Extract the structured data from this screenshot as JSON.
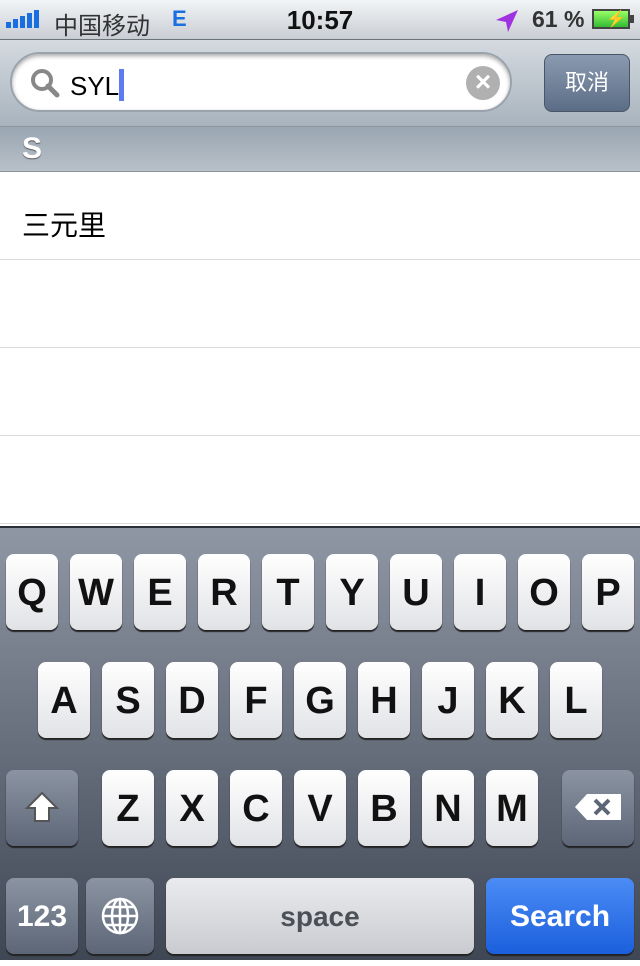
{
  "status": {
    "carrier": "中国移动",
    "network": "E",
    "time": "10:57",
    "battery": "61 %",
    "battery_level": 0.61,
    "colors": {
      "signal": "#1a6fe0",
      "location": "#a033e0"
    }
  },
  "search": {
    "value": "SYL",
    "clear_icon": "clear-circle-icon",
    "cancel_label": "取消"
  },
  "section": {
    "header": "S"
  },
  "results": [
    {
      "label": "三元里"
    },
    {
      "label": ""
    },
    {
      "label": ""
    },
    {
      "label": ""
    }
  ],
  "keyboard": {
    "row1": [
      "Q",
      "W",
      "E",
      "R",
      "T",
      "Y",
      "U",
      "I",
      "O",
      "P"
    ],
    "row2": [
      "A",
      "S",
      "D",
      "F",
      "G",
      "H",
      "J",
      "K",
      "L"
    ],
    "row3": [
      "Z",
      "X",
      "C",
      "V",
      "B",
      "N",
      "M"
    ],
    "numbers_label": "123",
    "space_label": "space",
    "search_label": "Search",
    "accent": "#1b5fdc"
  }
}
